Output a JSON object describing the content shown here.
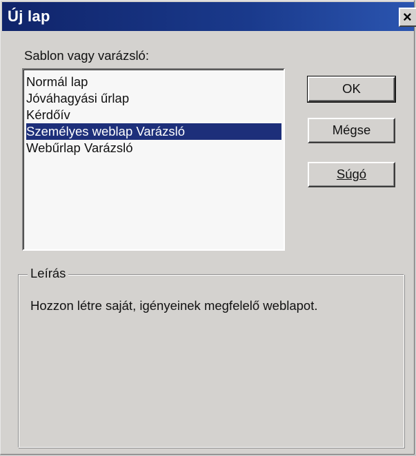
{
  "window": {
    "title": "Új lap",
    "close_glyph": "×"
  },
  "template_label": "Sablon vagy varázsló:",
  "templates": [
    {
      "label": "Normál lap",
      "selected": false
    },
    {
      "label": "Jóváhagyási űrlap",
      "selected": false
    },
    {
      "label": "Kérdőív",
      "selected": false
    },
    {
      "label": "Személyes weblap Varázsló",
      "selected": true
    },
    {
      "label": "Webűrlap Varázsló",
      "selected": false
    }
  ],
  "buttons": {
    "ok": "OK",
    "cancel": "Mégse",
    "help": "Súgó"
  },
  "description": {
    "title": "Leírás",
    "text": "Hozzon létre saját, igényeinek megfelelő weblapot."
  },
  "colors": {
    "titlebar": "#10246a",
    "selection": "#1d2f7a",
    "dialog_bg": "#d4d2cf"
  }
}
